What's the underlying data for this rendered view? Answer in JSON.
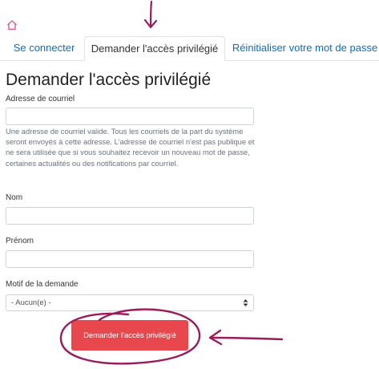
{
  "nav": {
    "home_icon": "home-icon"
  },
  "tabs": [
    {
      "label": "Se connecter",
      "active": false
    },
    {
      "label": "Demander l'accès privilégié",
      "active": true
    },
    {
      "label": "Réinitialiser votre mot de passe",
      "active": false
    }
  ],
  "page": {
    "title": "Demander l'accès privilégié"
  },
  "form": {
    "email": {
      "label": "Adresse de courriel",
      "value": "",
      "help": "Une adresse de courriel valide. Tous les courriels de la part du système seront envoyés à cette adresse. L'adresse de courriel n'est pas publique et ne sera utilisée que si vous souhaitez recevoir un nouveau mot de passe, certaines actualités ou des notifications par courriel."
    },
    "nom": {
      "label": "Nom",
      "value": ""
    },
    "prenom": {
      "label": "Prénom",
      "value": ""
    },
    "motif": {
      "label": "Motif de la demande",
      "selected": "- Aucun(e) -"
    },
    "submit_label": "Demander l'accès privilégié"
  },
  "colors": {
    "link": "#0f6cbf",
    "submit_bg": "#e8474e",
    "annotation": "#9b1c5c",
    "home_icon": "#e05a86"
  }
}
